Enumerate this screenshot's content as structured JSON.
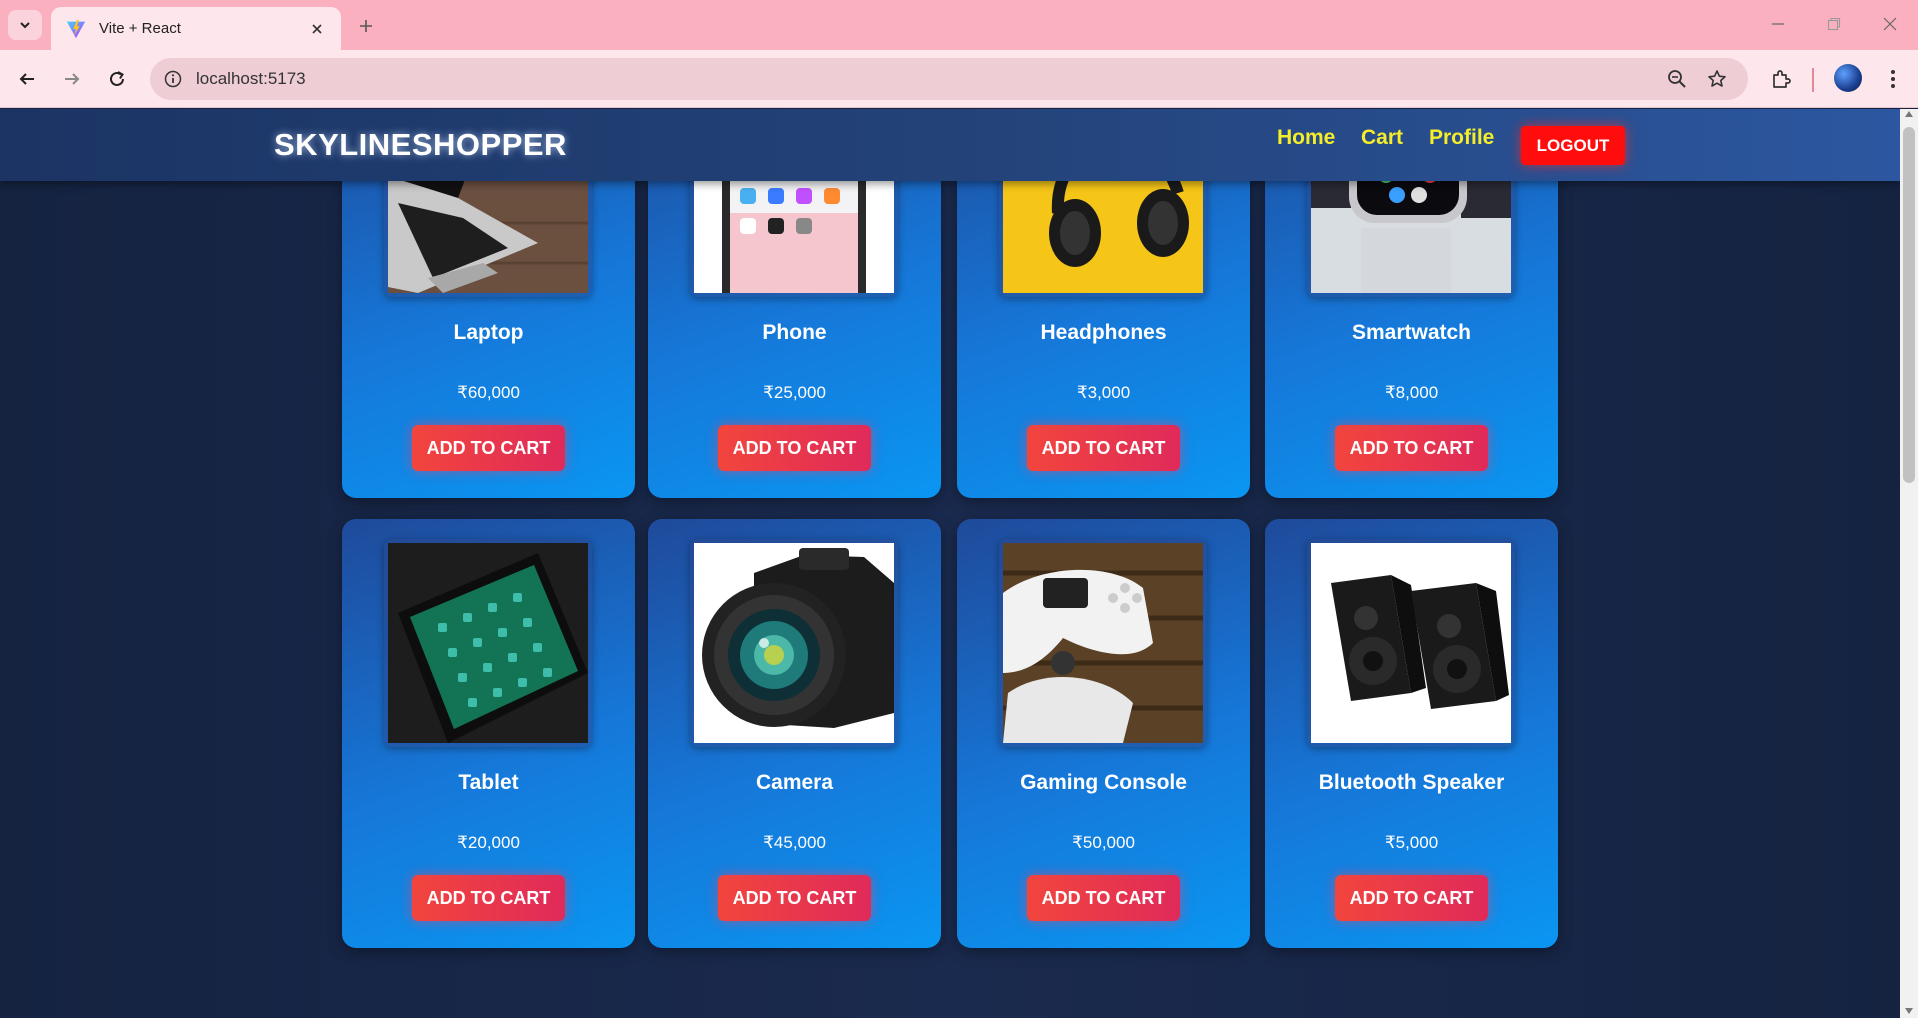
{
  "browser": {
    "tab_title": "Vite + React",
    "url": "localhost:5173"
  },
  "app": {
    "brand": "SKYLINESHOPPER",
    "nav": {
      "home": "Home",
      "cart": "Cart",
      "profile": "Profile",
      "logout": "LOGOUT"
    },
    "colors": {
      "header_bg": "#234278",
      "nav_link": "#f5ec2a",
      "logout_bg": "#ff0d0d",
      "card_bg": "#1677d8",
      "add_button": "#f2453d"
    }
  },
  "products": [
    {
      "name": "Laptop",
      "price": "₹60,000",
      "button": "ADD TO CART",
      "image": "laptop-image"
    },
    {
      "name": "Phone",
      "price": "₹25,000",
      "button": "ADD TO CART",
      "image": "phone-image"
    },
    {
      "name": "Headphones",
      "price": "₹3,000",
      "button": "ADD TO CART",
      "image": "headphones-image"
    },
    {
      "name": "Smartwatch",
      "price": "₹8,000",
      "button": "ADD TO CART",
      "image": "smartwatch-image"
    },
    {
      "name": "Tablet",
      "price": "₹20,000",
      "button": "ADD TO CART",
      "image": "tablet-image"
    },
    {
      "name": "Camera",
      "price": "₹45,000",
      "button": "ADD TO CART",
      "image": "camera-image"
    },
    {
      "name": "Gaming Console",
      "price": "₹50,000",
      "button": "ADD TO CART",
      "image": "gaming-console-image"
    },
    {
      "name": "Bluetooth Speaker",
      "price": "₹5,000",
      "button": "ADD TO CART",
      "image": "bluetooth-speaker-image"
    }
  ]
}
